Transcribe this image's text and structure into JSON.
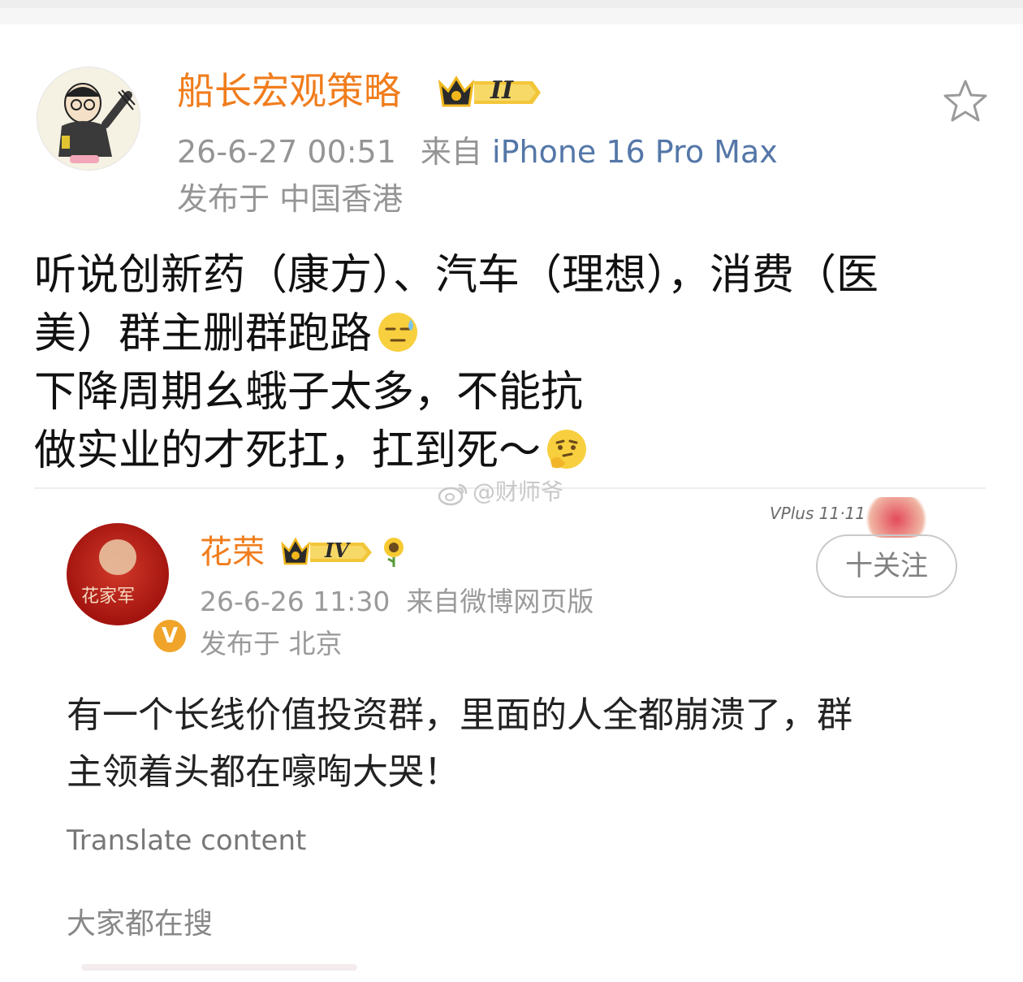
{
  "post": {
    "username": "船长宏观策略",
    "level_badge": "II",
    "timestamp": "26-6-27 00:51",
    "source_prefix": "来自",
    "device": "iPhone 16 Pro Max",
    "location": "发布于 中国香港",
    "lines": [
      "听说创新药（康方）、汽车（理想），消费（医",
      "美）群主删群跑路",
      "下降周期幺蛾子太多，不能抗",
      "做实业的才死扛，扛到死～"
    ],
    "emojis": [
      "sweat-emoji",
      "thinking-emoji"
    ]
  },
  "watermark": "@财师爷",
  "embedded": {
    "avatar_brand": "花家军",
    "verified_mark": "V",
    "username": "花荣",
    "level_badge": "IV",
    "vplus_label": "VPlus 11·11",
    "follow_label": "十关注",
    "timestamp": "26-6-26 11:30",
    "source": "来自微博网页版",
    "location": "发布于 北京",
    "lines": [
      "有一个长线价值投资群，里面的人全都崩溃了，群",
      "主领着头都在嚎啕大哭！"
    ],
    "translate_label": "Translate content",
    "search_hint": "大家都在搜"
  },
  "colors": {
    "username": "#f07d1d",
    "meta": "#959595",
    "device_link": "#5477a8",
    "text": "#111111"
  }
}
